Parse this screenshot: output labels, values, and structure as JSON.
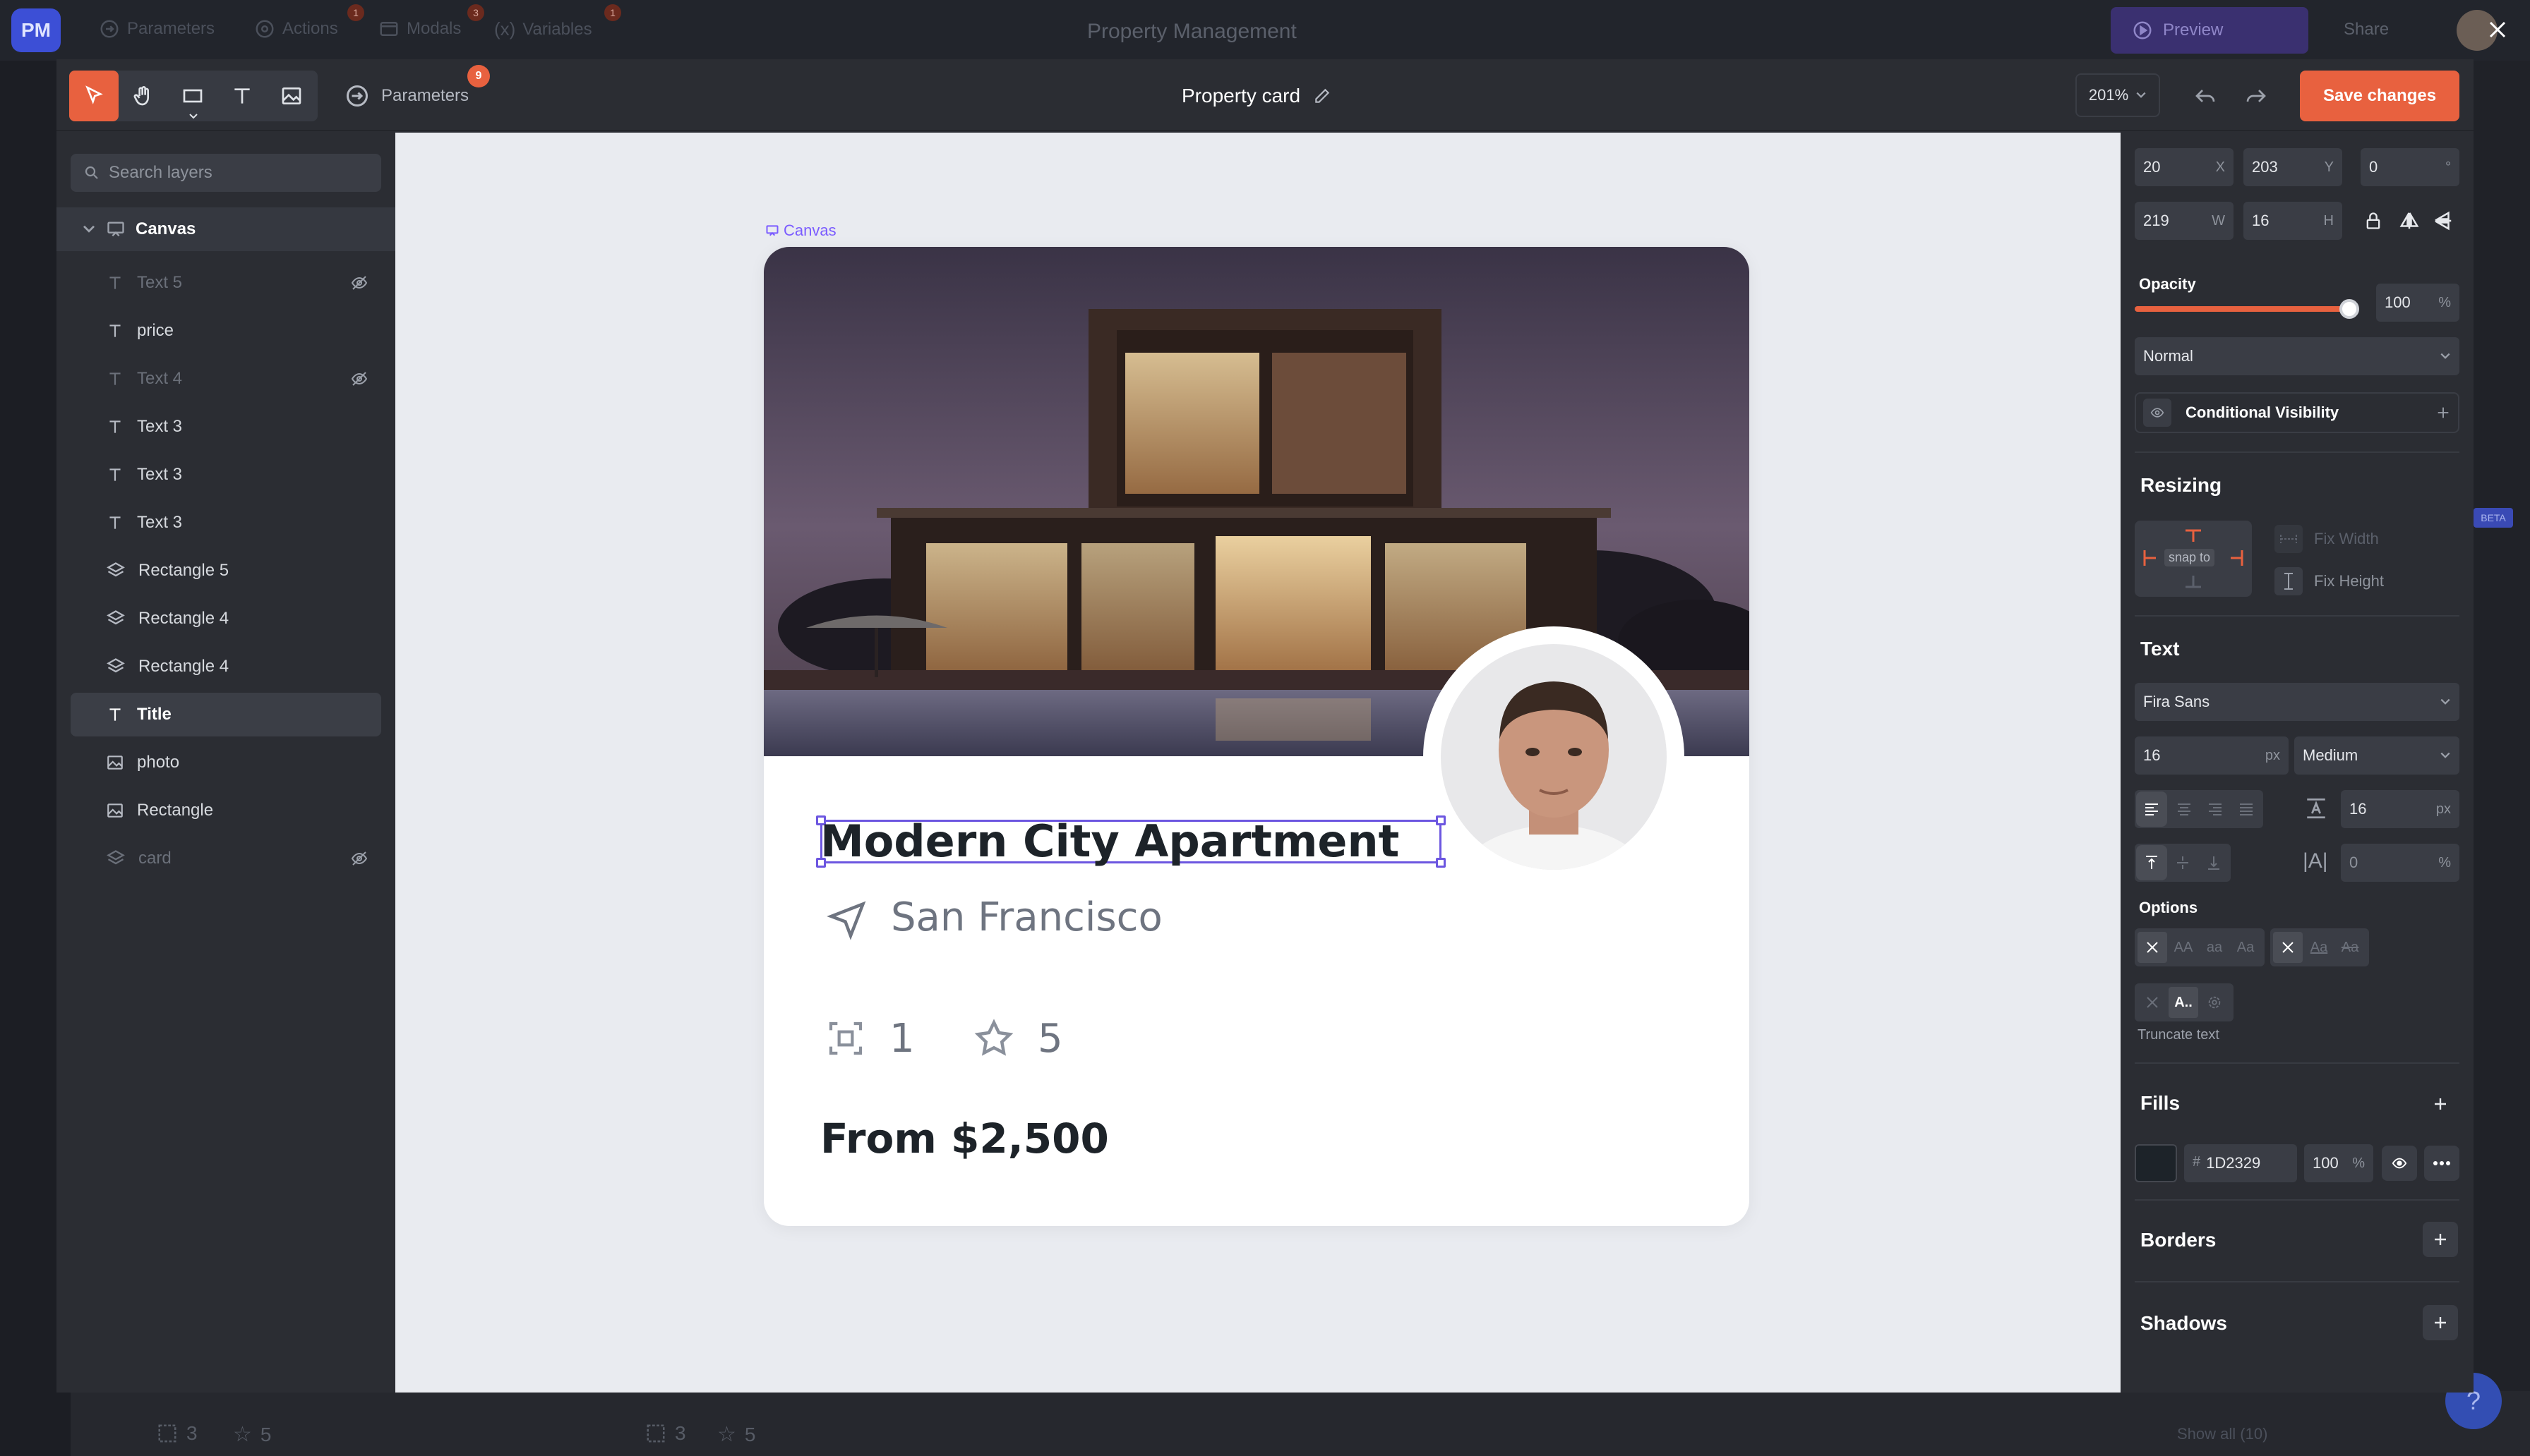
{
  "app": {
    "logo": "PM",
    "project_title": "Property Management",
    "nav": [
      {
        "label": "Parameters",
        "icon": "parameters-icon"
      },
      {
        "label": "Actions",
        "icon": "actions-icon",
        "badge": "1"
      },
      {
        "label": "Modals",
        "icon": "modals-icon",
        "badge": "3"
      },
      {
        "label": "Variables",
        "icon": "variables-icon",
        "badge": "1"
      }
    ],
    "preview_label": "Preview",
    "share_label": "Share",
    "bottom_stats": [
      {
        "icon": "rooms-icon",
        "value": "3"
      },
      {
        "icon": "star-icon",
        "value": "5"
      },
      {
        "icon": "rooms-icon",
        "value": "3"
      },
      {
        "icon": "star-icon",
        "value": "5"
      }
    ],
    "show_all_label": "Show all (10)",
    "beta_label": "BETA",
    "help_label": "?"
  },
  "editor": {
    "params_label": "Parameters",
    "params_badge": "9",
    "title": "Property card",
    "zoom": "201%",
    "save_label": "Save changes"
  },
  "layers": {
    "search_placeholder": "Search layers",
    "root": "Canvas",
    "items": [
      {
        "label": "Text 5",
        "type": "text",
        "hidden": true
      },
      {
        "label": "price",
        "type": "text",
        "hidden": false
      },
      {
        "label": "Text 4",
        "type": "text",
        "hidden": true
      },
      {
        "label": "Text 3",
        "type": "text",
        "hidden": false
      },
      {
        "label": "Text 3",
        "type": "text",
        "hidden": false
      },
      {
        "label": "Text 3",
        "type": "text",
        "hidden": false
      },
      {
        "label": "Rectangle 5",
        "type": "layers",
        "hidden": false
      },
      {
        "label": "Rectangle 4",
        "type": "layers",
        "hidden": false
      },
      {
        "label": "Rectangle 4",
        "type": "layers",
        "hidden": false
      },
      {
        "label": "Title",
        "type": "text",
        "hidden": false,
        "selected": true
      },
      {
        "label": "photo",
        "type": "image",
        "hidden": false
      },
      {
        "label": "Rectangle",
        "type": "image",
        "hidden": false
      },
      {
        "label": "card",
        "type": "layers",
        "hidden": true
      }
    ]
  },
  "canvas": {
    "label": "Canvas",
    "card": {
      "title": "Modern City Apartment",
      "location": "San Francisco",
      "rooms": "1",
      "rating": "5",
      "price": "From $2,500"
    }
  },
  "props": {
    "x": "20",
    "x_suffix": "X",
    "y": "203",
    "y_suffix": "Y",
    "rotation": "0",
    "rotation_suffix": "°",
    "w": "219",
    "w_suffix": "W",
    "h": "16",
    "h_suffix": "H",
    "opacity_label": "Opacity",
    "opacity": "100",
    "opacity_fraction": 1.0,
    "pct": "%",
    "blend_mode": "Normal",
    "conditional_visibility": "Conditional Visibility",
    "resizing_label": "Resizing",
    "snap_to": "snap to",
    "fix_width": "Fix Width",
    "fix_height": "Fix Height",
    "text_label": "Text",
    "font_family": "Fira Sans",
    "font_size": "16",
    "px": "px",
    "font_weight": "Medium",
    "line_height": "16",
    "letter_spacing": "0",
    "options_label": "Options",
    "case_options": [
      "AA",
      "aa",
      "Aa"
    ],
    "deco_options": [
      "Aa",
      "Aa"
    ],
    "truncate_label": "Truncate text",
    "truncate_glyph": "A..",
    "fills_label": "Fills",
    "fill_hash": "#",
    "fill_hex": "1D2329",
    "fill_opacity": "100",
    "borders_label": "Borders",
    "shadows_label": "Shadows"
  },
  "colors": {
    "accent": "#e8613f",
    "selection": "#6c56e0",
    "title_text": "#1d2329",
    "muted_text": "#6e7480"
  }
}
